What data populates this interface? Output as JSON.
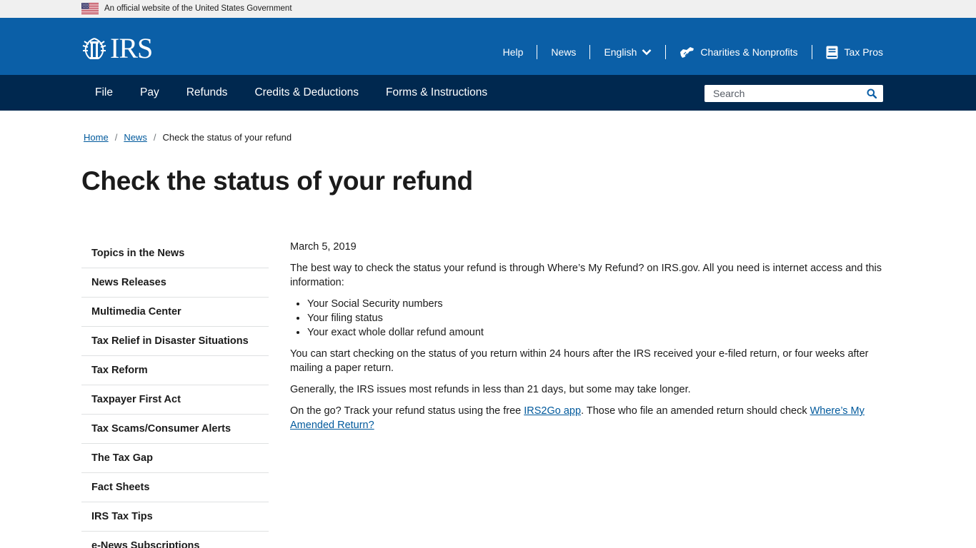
{
  "gov_banner": {
    "text": "An official website of the United States Government",
    "flag_icon": "us-flag-icon"
  },
  "header": {
    "logo_text": "IRS",
    "logo_icon": "irs-eagle-icon",
    "util_nav": {
      "help": "Help",
      "news": "News",
      "language": "English",
      "charities": "Charities & Nonprofits",
      "tax_pros": "Tax Pros"
    }
  },
  "main_nav": {
    "items": [
      "File",
      "Pay",
      "Refunds",
      "Credits & Deductions",
      "Forms & Instructions"
    ],
    "search_placeholder": "Search"
  },
  "breadcrumb": {
    "home": "Home",
    "news": "News",
    "current": "Check the status of your refund",
    "separator": "/"
  },
  "page": {
    "title": "Check the status of your refund"
  },
  "sidebar": {
    "items": [
      "Topics in the News",
      "News Releases",
      "Multimedia Center",
      "Tax Relief in Disaster Situations",
      "Tax Reform",
      "Taxpayer First Act",
      "Tax Scams/Consumer Alerts",
      "The Tax Gap",
      "Fact Sheets",
      "IRS Tax Tips",
      "e-News Subscriptions"
    ]
  },
  "content": {
    "date": "March 5, 2019",
    "intro": "The best way to check the status your refund is through Where’s My Refund? on IRS.gov. All you need is internet access and this information:",
    "list": [
      "Your Social Security numbers",
      "Your filing status",
      "Your exact whole dollar refund amount"
    ],
    "para2": "You can start checking on the status of you return within 24 hours after the IRS received your e-filed return, or four weeks after mailing a paper return.",
    "para3": "Generally, the IRS issues most refunds in less than 21 days, but some may take longer.",
    "para4_before": "On the go? Track your refund status using the free ",
    "para4_link1": "IRS2Go app",
    "para4_middle": ". Those who file an amended return should check ",
    "para4_link2": "Where’s My Amended Return?"
  },
  "colors": {
    "header_blue": "#0b5fa7",
    "nav_navy": "#00284f",
    "link_blue": "#00599c"
  }
}
